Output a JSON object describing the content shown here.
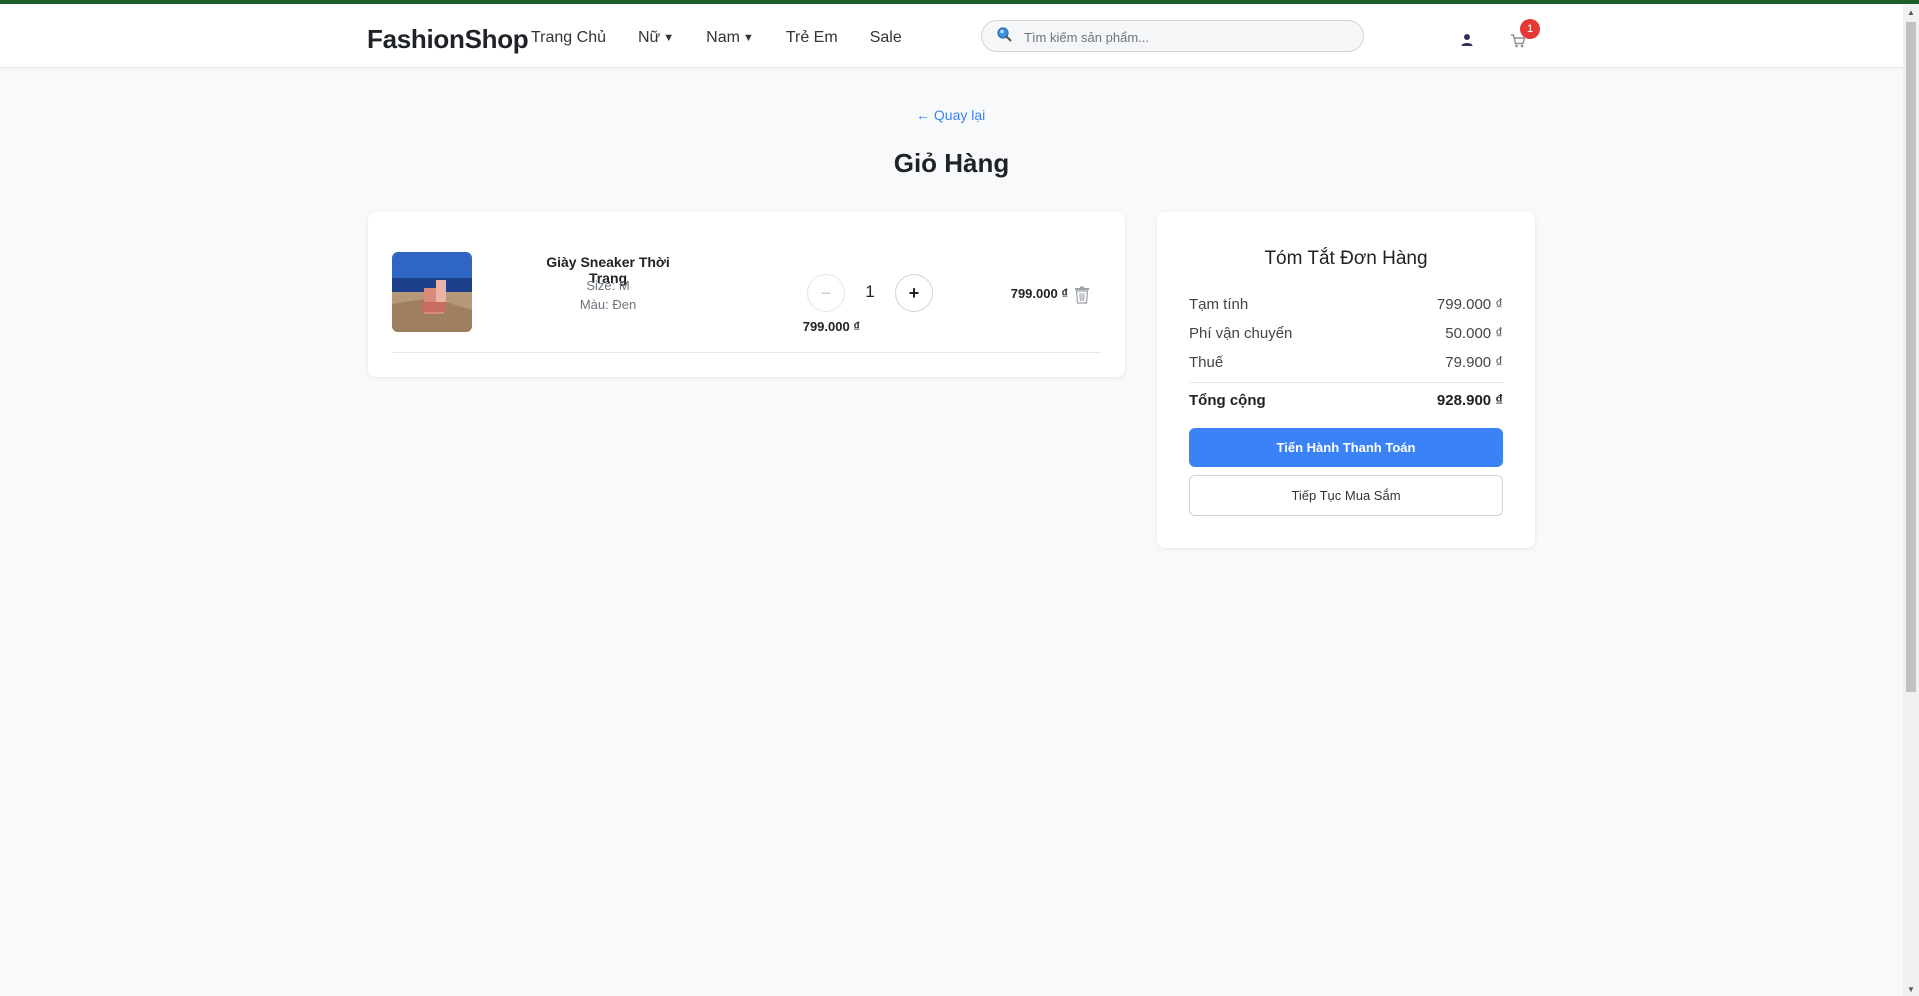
{
  "header": {
    "logo": "FashionShop",
    "nav": [
      {
        "label": "Trang Chủ",
        "caret": ""
      },
      {
        "label": "Nữ",
        "caret": "▼"
      },
      {
        "label": "Nam",
        "caret": "▼"
      },
      {
        "label": "Trẻ Em",
        "caret": ""
      },
      {
        "label": "Sale",
        "caret": ""
      }
    ],
    "search_placeholder": "Tìm kiếm sản phẩm...",
    "cart_count": "1"
  },
  "page": {
    "back_link": "← Quay lại",
    "title": "Giỏ Hàng"
  },
  "cart": {
    "items": [
      {
        "name": "Giày Sneaker Thời Trang",
        "size": "Size: M",
        "color": "Màu: Đen",
        "unit_price": "799.000 ₫",
        "quantity": "1",
        "minus": "−",
        "plus": "+",
        "total": "799.000 ₫"
      }
    ]
  },
  "summary": {
    "title": "Tóm Tắt Đơn Hàng",
    "subtotal_label": "Tạm tính",
    "subtotal_value": "799.000 ₫",
    "shipping_label": "Phí vận chuyển",
    "shipping_value": "50.000 ₫",
    "tax_label": "Thuế",
    "tax_value": "79.900 ₫",
    "total_label": "Tổng cộng",
    "total_value": "928.900 ₫",
    "checkout_button": "Tiến Hành Thanh Toán",
    "continue_button": "Tiếp Tục Mua Sắm"
  },
  "colors": {
    "accent": "#3b82f6",
    "top_bar": "#1d5e2a",
    "badge": "#e53935"
  },
  "icons": [
    "search-icon",
    "user-icon",
    "cart-icon",
    "trash-icon",
    "chevron-down-icon"
  ]
}
